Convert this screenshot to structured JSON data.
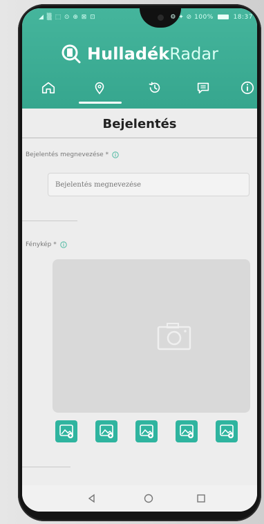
{
  "status_bar": {
    "left": "◢ ▒ ⬚ ⊙ ⊕ ⊠ ⊡",
    "right": "⚙ ✦ ⊘ 100%",
    "time": "18:37"
  },
  "app": {
    "brand_bold": "Hulladék",
    "brand_light": "Radar"
  },
  "nav": {
    "items": [
      {
        "icon": "home-icon"
      },
      {
        "icon": "map-pin-icon"
      },
      {
        "icon": "history-icon"
      },
      {
        "icon": "message-icon"
      },
      {
        "icon": "info-icon"
      }
    ]
  },
  "page": {
    "title": "Bejelentés"
  },
  "form": {
    "name_label": "Bejelentés megnevezése *",
    "name_placeholder": "Bejelentés megnevezése",
    "photo_label": "Fénykép *"
  },
  "colors": {
    "header": "#3aa991",
    "accent": "#2fb49f",
    "background": "#ededed"
  }
}
